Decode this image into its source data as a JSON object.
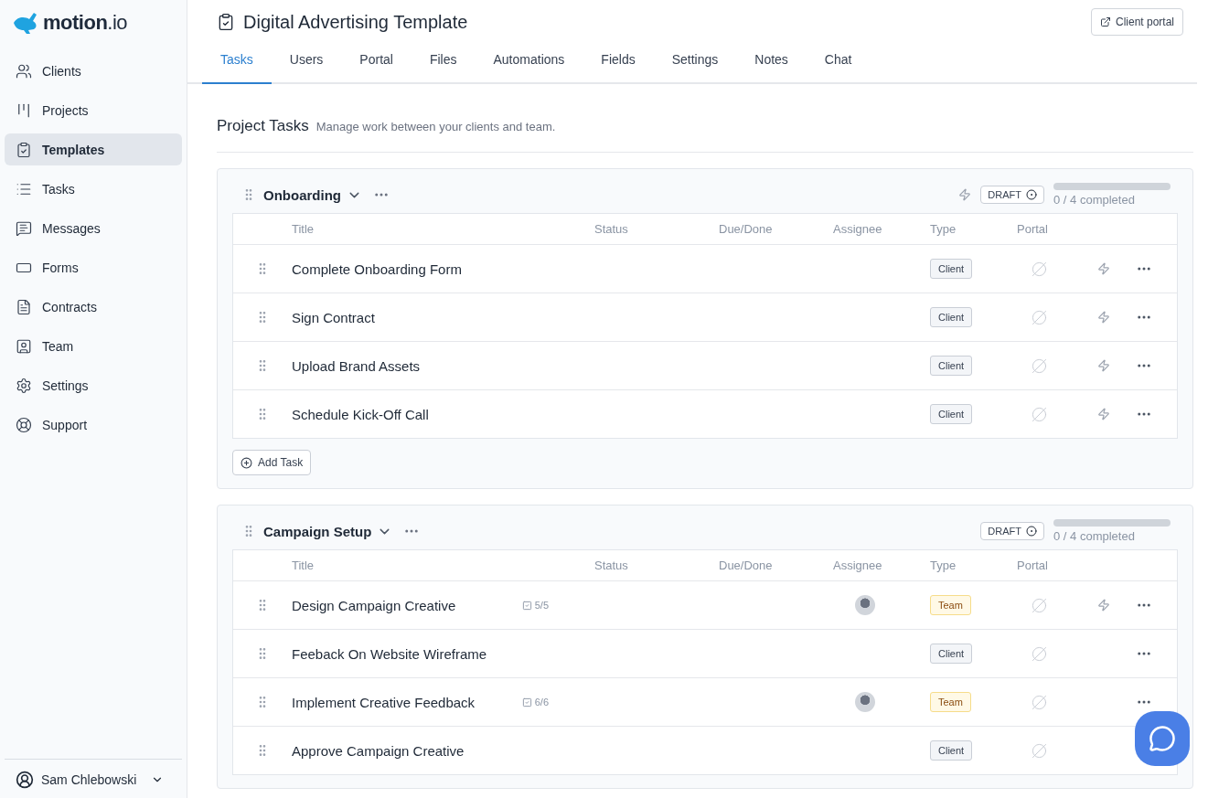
{
  "brand": {
    "name": "motion",
    "suffix": ".io"
  },
  "sidebar": {
    "items": [
      {
        "label": "Clients",
        "selected": false
      },
      {
        "label": "Projects",
        "selected": false
      },
      {
        "label": "Templates",
        "selected": true
      },
      {
        "label": "Tasks",
        "selected": false
      },
      {
        "label": "Messages",
        "selected": false
      },
      {
        "label": "Forms",
        "selected": false
      },
      {
        "label": "Contracts",
        "selected": false
      },
      {
        "label": "Team",
        "selected": false
      },
      {
        "label": "Settings",
        "selected": false
      },
      {
        "label": "Support",
        "selected": false
      }
    ],
    "user": "Sam Chlebowski"
  },
  "page": {
    "title": "Digital Advertising Template",
    "client_portal_button": "Client portal"
  },
  "tabs": [
    {
      "label": "Tasks",
      "selected": true
    },
    {
      "label": "Users",
      "selected": false
    },
    {
      "label": "Portal",
      "selected": false
    },
    {
      "label": "Files",
      "selected": false
    },
    {
      "label": "Automations",
      "selected": false
    },
    {
      "label": "Fields",
      "selected": false
    },
    {
      "label": "Settings",
      "selected": false
    },
    {
      "label": "Notes",
      "selected": false
    },
    {
      "label": "Chat",
      "selected": false
    }
  ],
  "section": {
    "title": "Project Tasks",
    "subtitle": "Manage work between your clients and team."
  },
  "groups": [
    {
      "name": "Onboarding",
      "automation": true,
      "status": "DRAFT",
      "level": 0,
      "progress": "0 / 4 completed",
      "add_button": "Add Task",
      "columns": [
        "Title",
        "Status",
        "Due/Done",
        "Assignee",
        "Type",
        "Portal"
      ],
      "rows": [
        {
          "title": "Complete Onboarding Form",
          "type": "Client",
          "kind": "client",
          "automation": true
        },
        {
          "title": "Sign Contract",
          "type": "Client",
          "kind": "client",
          "automation": true
        },
        {
          "title": "Upload Brand Assets",
          "type": "Client",
          "kind": "client",
          "automation": true
        },
        {
          "title": "Schedule Kick-Off Call",
          "type": "Client",
          "kind": "client",
          "automation": true
        }
      ]
    },
    {
      "name": "Campaign Setup",
      "automation": false,
      "status": "DRAFT",
      "level": 0,
      "progress": "0 / 4 completed",
      "columns": [
        "Title",
        "Status",
        "Due/Done",
        "Assignee",
        "Type",
        "Portal"
      ],
      "rows": [
        {
          "title": "Design Campaign Creative",
          "checklist": "5/5",
          "assignee": true,
          "type": "Team",
          "kind": "team",
          "automation": true
        },
        {
          "title": "Feeback On Website Wireframe",
          "assignee": false,
          "type": "Client",
          "kind": "client",
          "automation": false
        },
        {
          "title": "Implement Creative Feedback",
          "checklist": "6/6",
          "assignee": true,
          "type": "Team",
          "kind": "team",
          "automation": false
        },
        {
          "title": "Approve Campaign Creative",
          "assignee": false,
          "type": "Client",
          "kind": "client",
          "automation": false
        }
      ]
    }
  ]
}
